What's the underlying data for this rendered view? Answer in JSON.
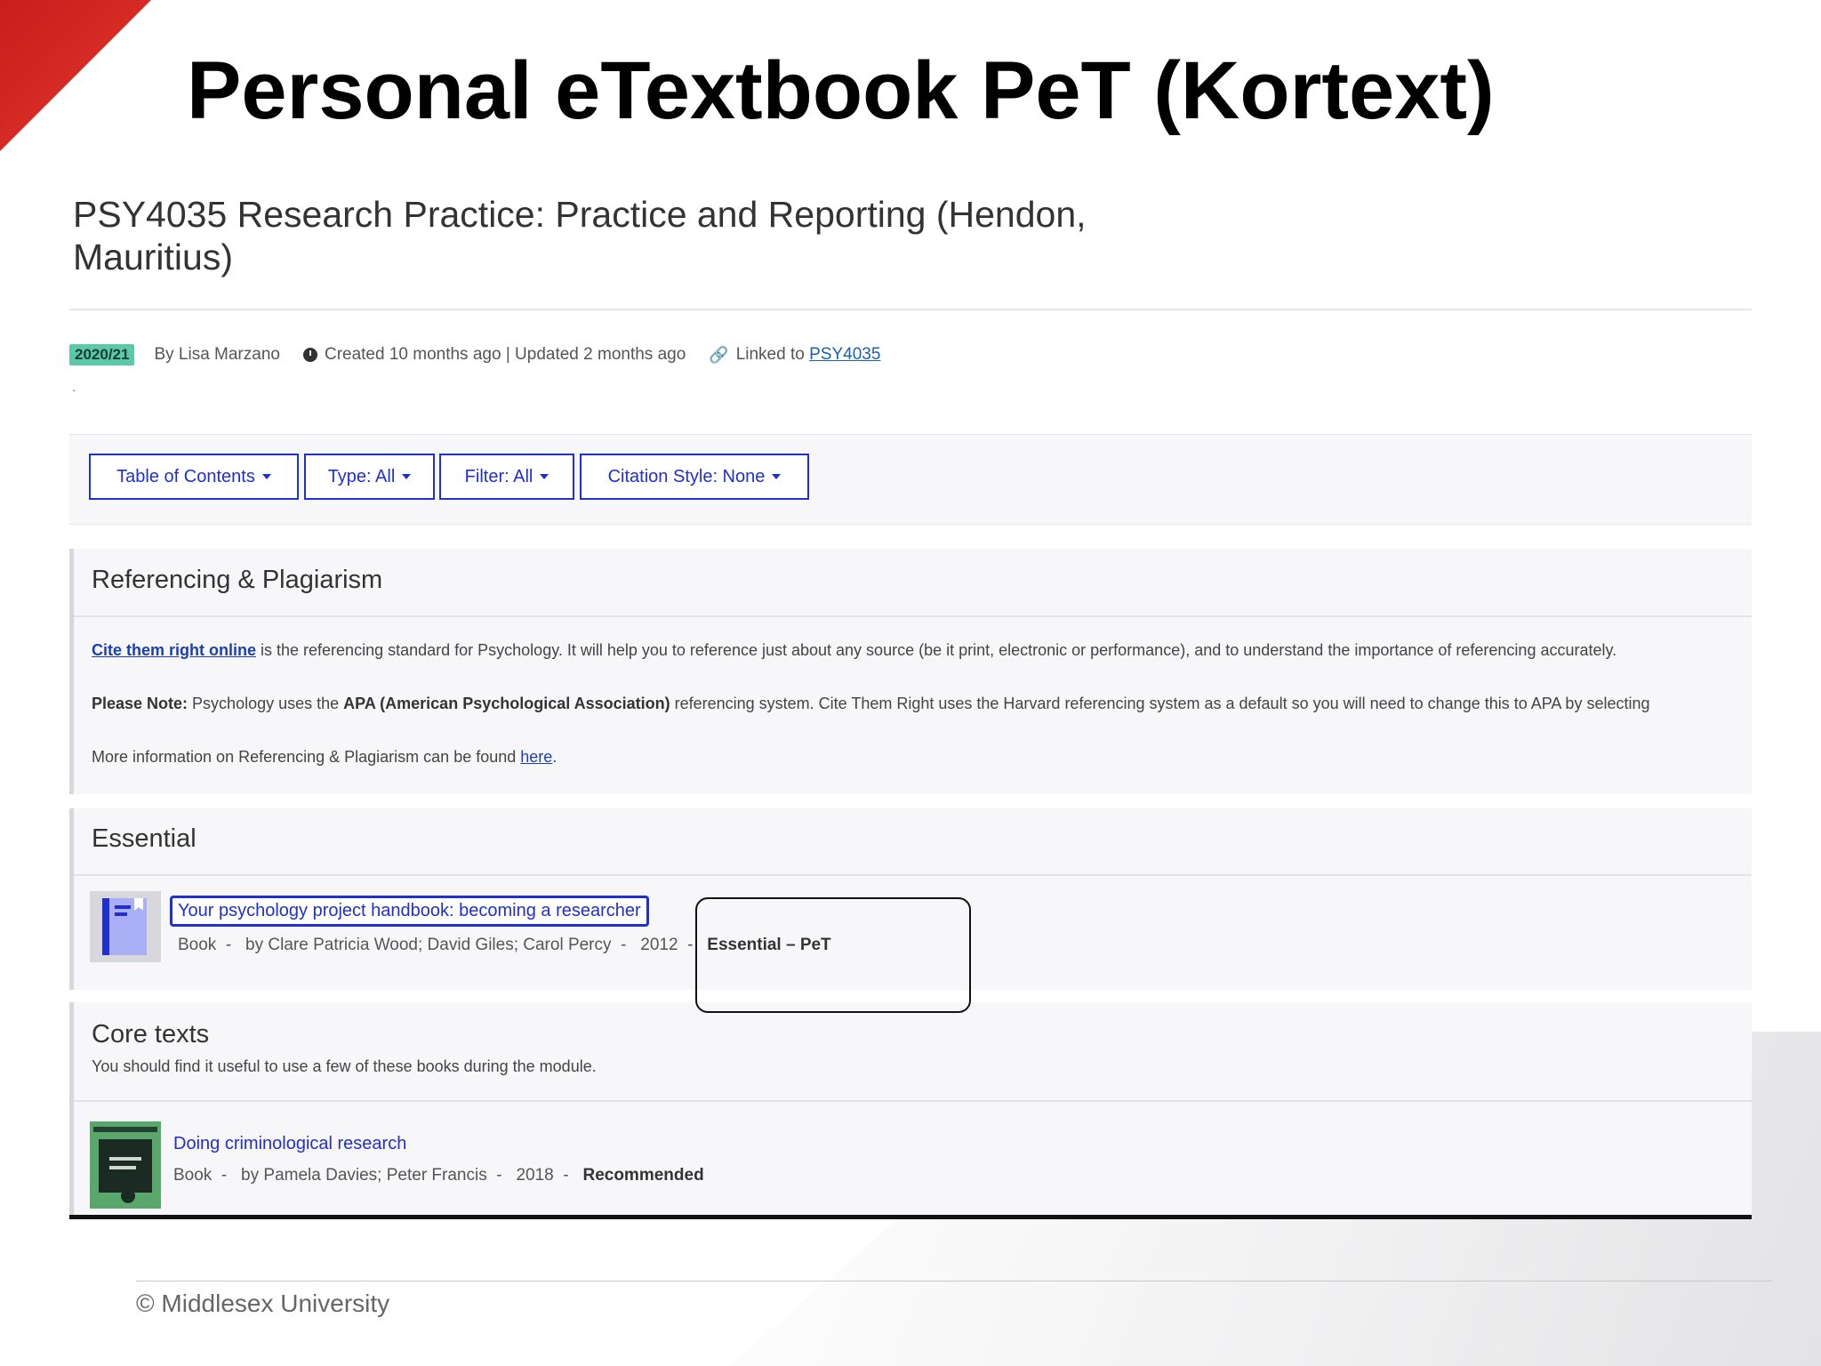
{
  "slide": {
    "title": "Personal eTextbook PeT (Kortext)",
    "footer": "© Middlesex University"
  },
  "list": {
    "title": "PSY4035 Research Practice: Practice and Reporting (Hendon, Mauritius)",
    "year_badge": "2020/21",
    "author": "By Lisa Marzano",
    "dates": "Created 10 months ago | Updated 2 months ago",
    "linked_label": "Linked to",
    "linked_code": "PSY4035",
    "dot": "."
  },
  "toolbar": {
    "buttons": [
      "Table of Contents",
      "Type: All",
      "Filter: All",
      "Citation Style: None"
    ]
  },
  "referencing": {
    "heading": "Referencing & Plagiarism",
    "p1_link": "Cite them right online",
    "p1_text": " is the referencing standard for Psychology.  It will help you to reference just about any source (be it print, electronic or performance), and to understand the importance of referencing accurately.",
    "p2_bold1": "Please Note:",
    "p2_text1": " Psychology uses the ",
    "p2_bold2": "APA (American Psychological Association)",
    "p2_text2": " referencing system.  Cite Them Right uses the Harvard referencing system as a default so you will need to change this to APA by selecting",
    "p3_text": "More information on Referencing & Plagiarism can be found ",
    "p3_link": "here",
    "p3_end": "."
  },
  "essential": {
    "heading": "Essential",
    "item": {
      "title": "Your psychology project handbook: becoming a researcher",
      "type": "Book",
      "authors": "by Clare Patricia Wood; David Giles; Carol Percy",
      "year": "2012",
      "tag": "Essential – PeT"
    }
  },
  "core": {
    "heading": "Core texts",
    "subtitle": "You should find it useful to use a few of these books during the module.",
    "item": {
      "title": "Doing criminological research",
      "type": "Book",
      "authors": "by Pamela Davies; Peter Francis",
      "year": "2018",
      "tag": "Recommended"
    }
  },
  "colors": {
    "accent_red": "#d42a22",
    "link_blue": "#1f2fd0",
    "badge_green": "#5bc8a8"
  }
}
